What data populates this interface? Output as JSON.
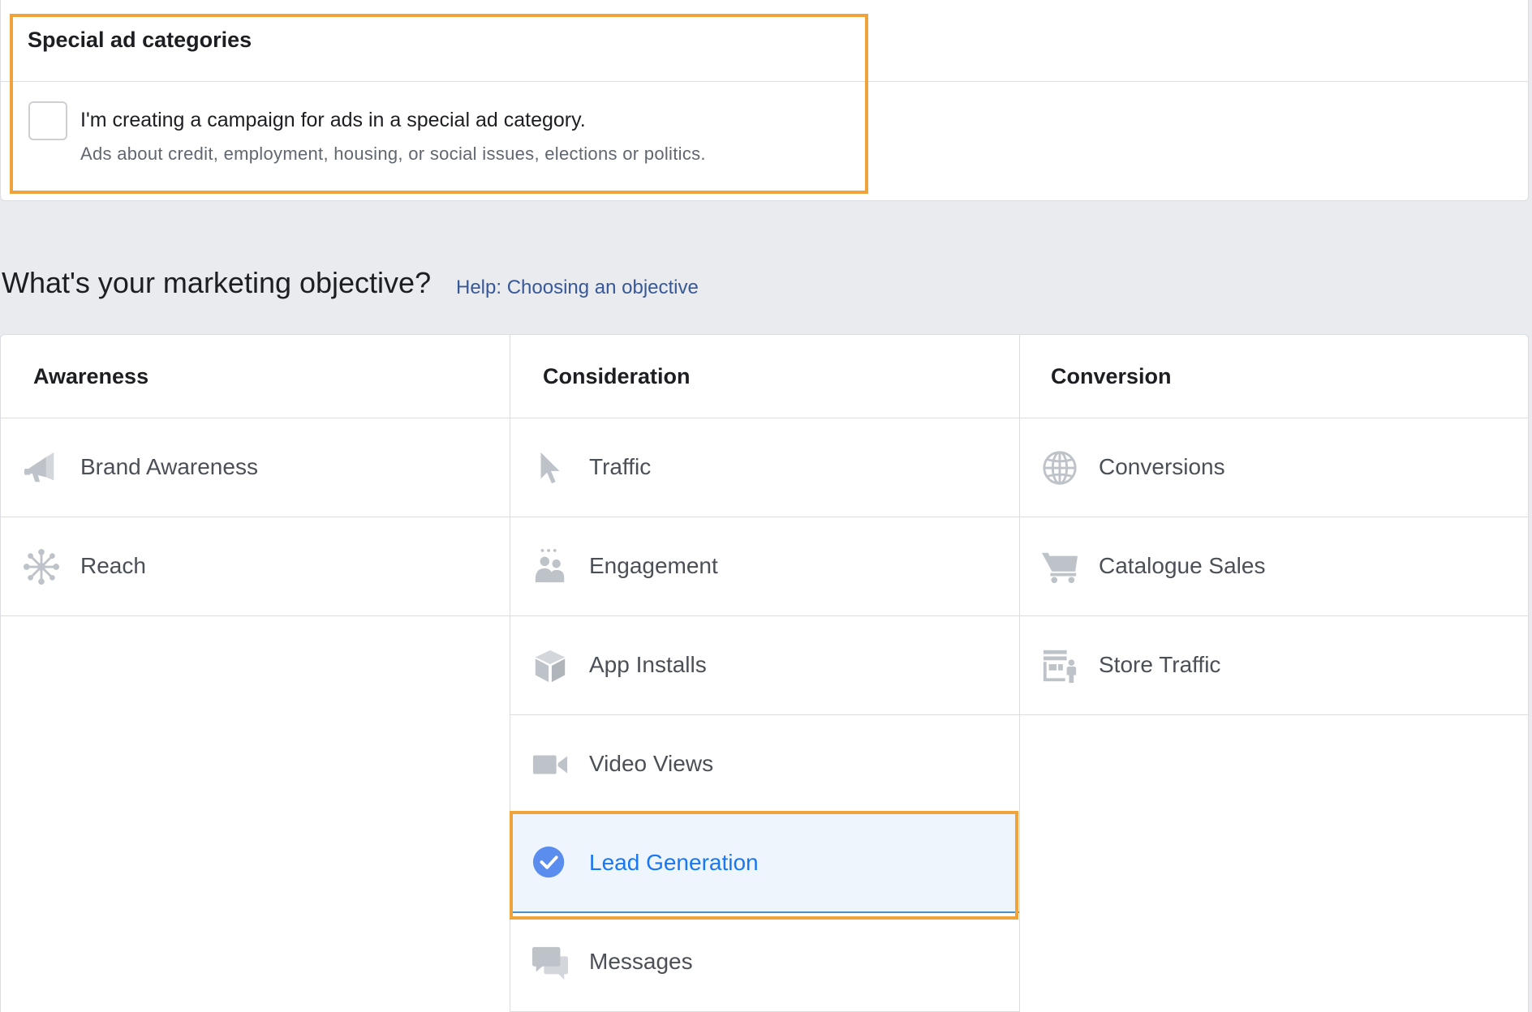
{
  "special": {
    "title": "Special ad categories",
    "checkbox_label": "I'm creating a campaign for ads in a special ad category.",
    "checkbox_description": "Ads about credit, employment, housing, or social issues, elections or politics.",
    "checked": false
  },
  "objective": {
    "title": "What's your marketing objective?",
    "help_link": "Help: Choosing an objective"
  },
  "columns": [
    {
      "header": "Awareness",
      "items": [
        {
          "label": "Brand Awareness",
          "icon": "megaphone-icon"
        },
        {
          "label": "Reach",
          "icon": "reach-icon"
        }
      ]
    },
    {
      "header": "Consideration",
      "items": [
        {
          "label": "Traffic",
          "icon": "cursor-icon"
        },
        {
          "label": "Engagement",
          "icon": "people-icon"
        },
        {
          "label": "App Installs",
          "icon": "box-icon"
        },
        {
          "label": "Video Views",
          "icon": "video-camera-icon"
        },
        {
          "label": "Lead Generation",
          "icon": "check-circle-icon",
          "selected": true
        },
        {
          "label": "Messages",
          "icon": "chat-bubbles-icon"
        }
      ]
    },
    {
      "header": "Conversion",
      "items": [
        {
          "label": "Conversions",
          "icon": "globe-icon"
        },
        {
          "label": "Catalogue Sales",
          "icon": "cart-icon"
        },
        {
          "label": "Store Traffic",
          "icon": "store-icon"
        }
      ]
    }
  ],
  "colors": {
    "accent": "#1877f2",
    "highlight": "#f0a23b",
    "icon_gray": "#bec3c9",
    "selected_check": "#5b8def"
  }
}
